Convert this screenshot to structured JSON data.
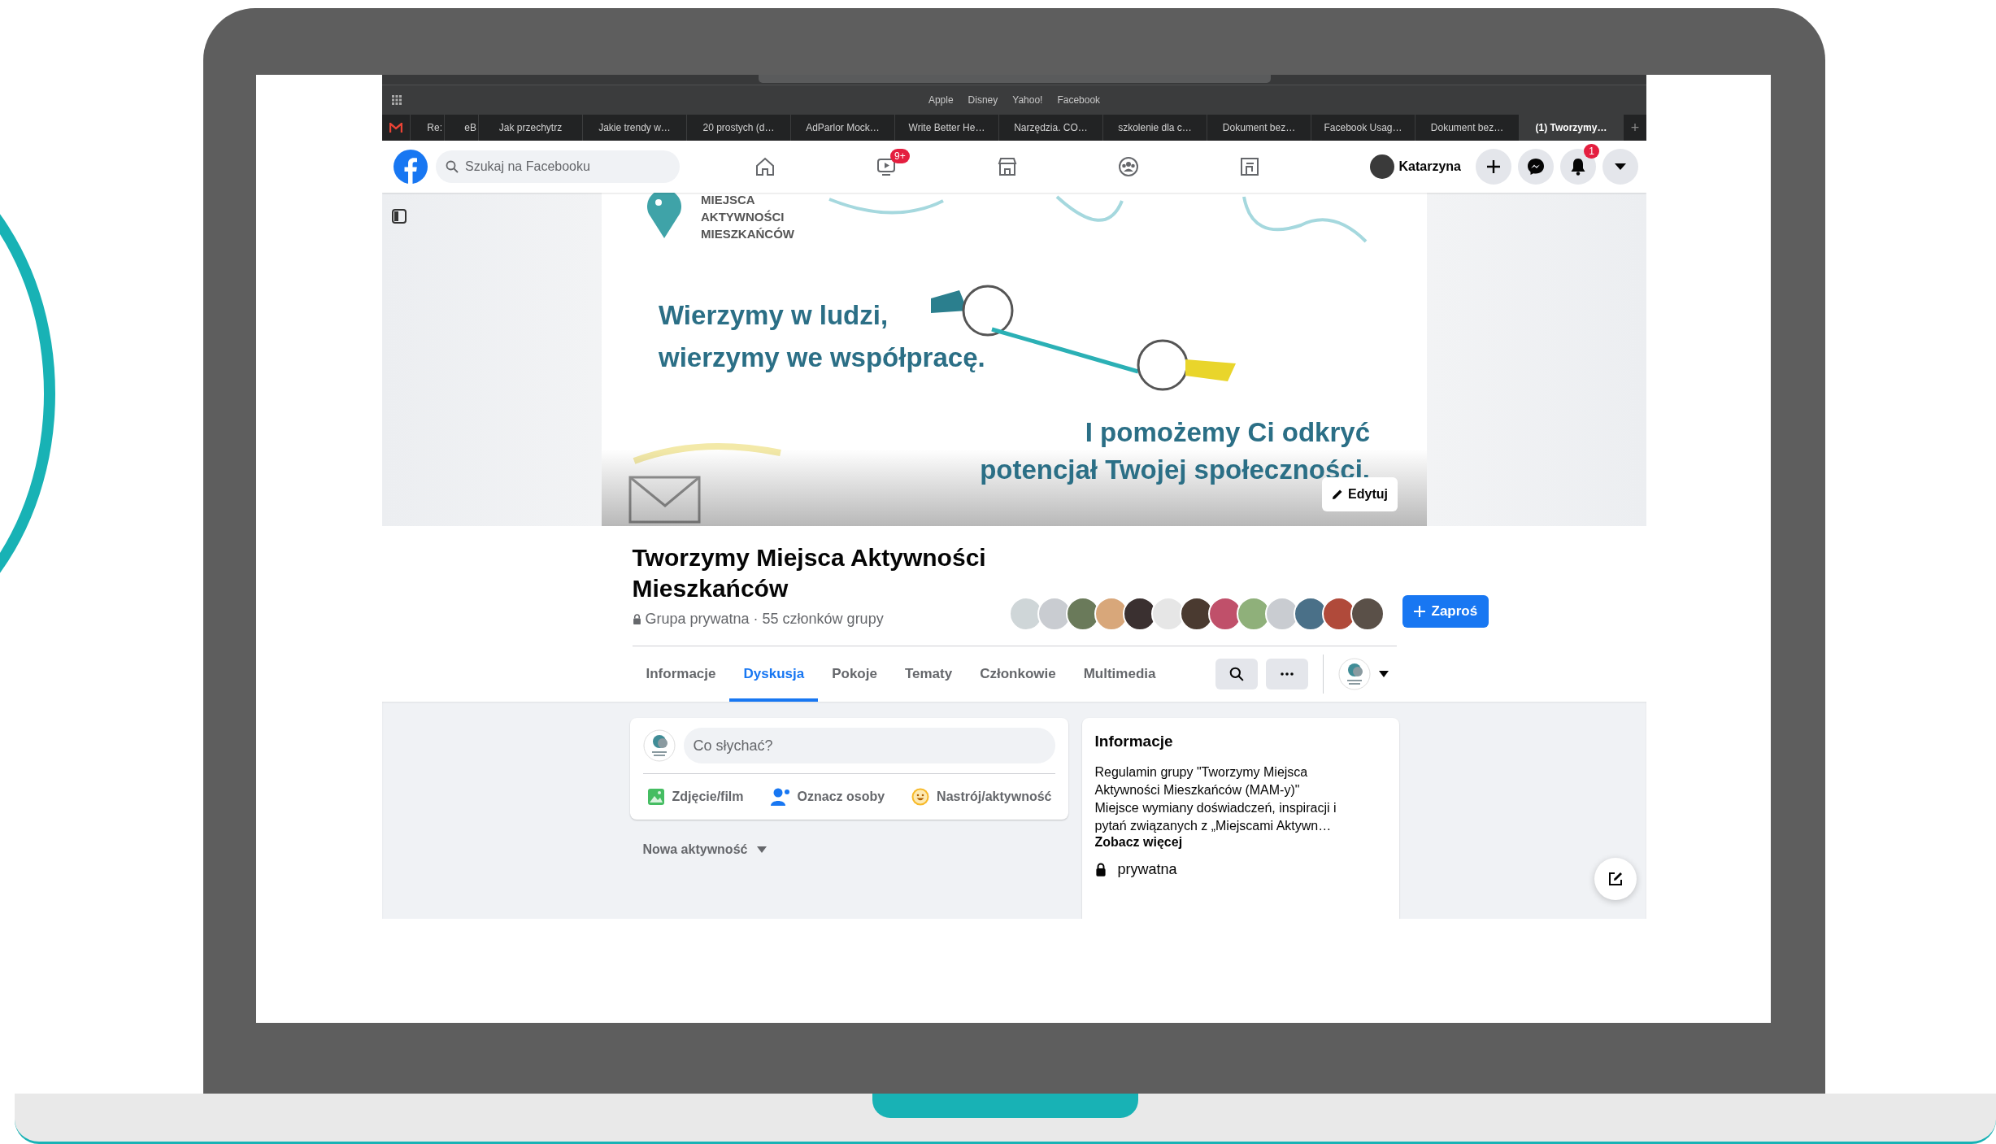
{
  "browser": {
    "bookmarks": [
      "Apple",
      "Disney",
      "Yahoo!",
      "Facebook"
    ],
    "tabs": [
      {
        "title": "Re:",
        "selected": false
      },
      {
        "title": "eB",
        "selected": false
      },
      {
        "title": "Jak przechytrz",
        "selected": false
      },
      {
        "title": "Jakie trendy w…",
        "selected": false
      },
      {
        "title": "20 prostych (d…",
        "selected": false
      },
      {
        "title": "AdParlor Mock…",
        "selected": false
      },
      {
        "title": "Write Better He…",
        "selected": false
      },
      {
        "title": "Narzędzia. CO…",
        "selected": false
      },
      {
        "title": "szkolenie dla c…",
        "selected": false
      },
      {
        "title": "Dokument bez…",
        "selected": false
      },
      {
        "title": "Facebook Usag…",
        "selected": false
      },
      {
        "title": "Dokument bez…",
        "selected": false
      },
      {
        "title": "(1) Tworzymy…",
        "selected": true
      }
    ],
    "new_tab": "+"
  },
  "header": {
    "search": {
      "placeholder": "Szukaj na Facebooku"
    },
    "nav": [
      {
        "kind": "home"
      },
      {
        "kind": "video",
        "badge": "9+"
      },
      {
        "kind": "marketplace"
      },
      {
        "kind": "groups"
      },
      {
        "kind": "gaming"
      }
    ],
    "profile": {
      "name": "Katarzyna"
    },
    "actions": [
      {
        "kind": "plus"
      },
      {
        "kind": "messenger"
      },
      {
        "kind": "bell",
        "badge": "1"
      },
      {
        "kind": "menu"
      }
    ]
  },
  "cover": {
    "logo_lines": [
      "MIEJSCA",
      "AKTYWNOŚCI",
      "MIESZKAŃCÓW"
    ],
    "headline": [
      "Wierzymy w ludzi,",
      "wierzymy we współpracę."
    ],
    "tagline": [
      "I pomożemy Ci odkryć",
      "potencjał Twojej społeczności."
    ],
    "edit_button": "Edytuj"
  },
  "group": {
    "title": "Tworzymy Miejsca Aktywności Mieszkańców",
    "privacy": "Grupa prywatna · 55 członków grupy",
    "invite_button": "Zaproś"
  },
  "tabs": [
    {
      "label": "Informacje",
      "selected": false
    },
    {
      "label": "Dyskusja",
      "selected": true
    },
    {
      "label": "Pokoje",
      "selected": false
    },
    {
      "label": "Tematy",
      "selected": false
    },
    {
      "label": "Członkowie",
      "selected": false
    },
    {
      "label": "Multimedia",
      "selected": false
    }
  ],
  "composer": {
    "placeholder": "Co słychać?",
    "actions": [
      {
        "kind": "photo",
        "label": "Zdjęcie/film"
      },
      {
        "kind": "tag",
        "label": "Oznacz osoby"
      },
      {
        "kind": "feeling",
        "label": "Nastrój/aktywność"
      }
    ]
  },
  "sort": {
    "label": "Nowa aktywność"
  },
  "about": {
    "title": "Informacje",
    "description_lines": [
      "Regulamin grupy \"Tworzymy Miejsca",
      "Aktywności Mieszkańców (MAM-y)\"",
      "Miejsce wymiany doświadczeń, inspiracji i",
      "pytań związanych z „Miejscami Aktywn…"
    ],
    "see_more": "Zobacz więcej",
    "privacy": "prywatna"
  }
}
